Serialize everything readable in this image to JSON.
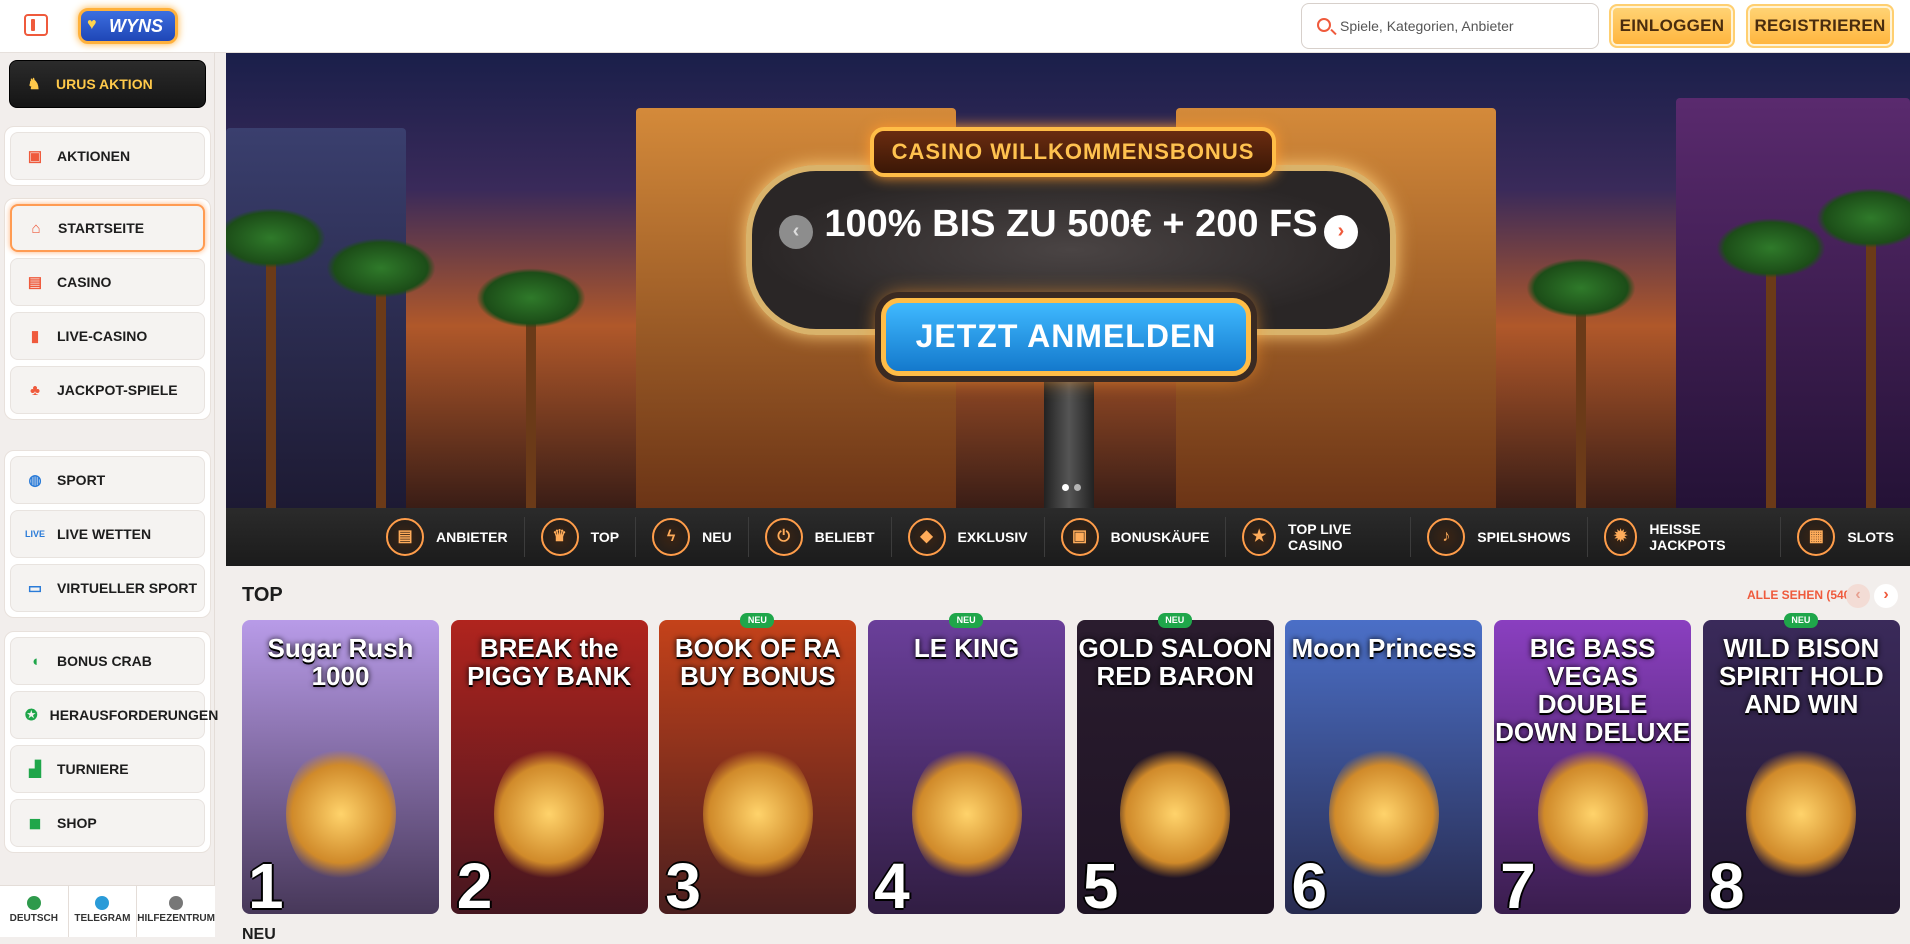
{
  "header": {
    "search_placeholder": "Spiele, Kategorien, Anbieter",
    "login_label": "EINLOGGEN",
    "register_label": "REGISTRIEREN",
    "logo_text": "WYNS"
  },
  "sidebar": {
    "promo": {
      "label": "URUS AKTION",
      "icon": "bull-icon"
    },
    "group1": [
      {
        "label": "AKTIONEN",
        "icon": "gift-icon"
      }
    ],
    "group2": [
      {
        "label": "STARTSEITE",
        "icon": "home-icon"
      },
      {
        "label": "CASINO",
        "icon": "slot-machine-icon"
      },
      {
        "label": "LIVE-CASINO",
        "icon": "cards-icon"
      },
      {
        "label": "JACKPOT-SPIELE",
        "icon": "clover-icon"
      }
    ],
    "group3": [
      {
        "label": "SPORT",
        "icon": "ball-icon"
      },
      {
        "label": "LIVE WETTEN",
        "icon": "live-icon"
      },
      {
        "label": "VIRTUELLER SPORT",
        "icon": "monitor-icon"
      }
    ],
    "group4": [
      {
        "label": "BONUS CRAB",
        "icon": "claw-icon"
      },
      {
        "label": "HERAUSFORDERUNGEN",
        "icon": "medal-icon"
      },
      {
        "label": "TURNIERE",
        "icon": "podium-icon"
      },
      {
        "label": "SHOP",
        "icon": "bag-icon"
      }
    ],
    "bottom": [
      {
        "label": "DEUTSCH",
        "icon": "globe-icon"
      },
      {
        "label": "TELEGRAM",
        "icon": "telegram-icon"
      },
      {
        "label": "HILFEZENTRUM",
        "icon": "help-icon"
      }
    ]
  },
  "banner": {
    "top_sign": "CASINO WILLKOMMENSBONUS",
    "headline": "100% BIS ZU 500€ + 200 FS",
    "cta": "JETZT ANMELDEN",
    "slides": 2,
    "active_slide": 1
  },
  "categories": [
    {
      "label": "ANBIETER",
      "icon": "document-icon"
    },
    {
      "label": "TOP",
      "icon": "crown-icon"
    },
    {
      "label": "NEU",
      "icon": "lightning-icon"
    },
    {
      "label": "BELIEBT",
      "icon": "power-icon"
    },
    {
      "label": "EXKLUSIV",
      "icon": "diamond-icon"
    },
    {
      "label": "BONUSKÄUFE",
      "icon": "gift-icon"
    },
    {
      "label": "TOP LIVE CASINO",
      "icon": "star-icon"
    },
    {
      "label": "SPIELSHOWS",
      "icon": "microphone-icon"
    },
    {
      "label": "HEISSE JACKPOTS",
      "icon": "flame-icon"
    },
    {
      "label": "SLOTS",
      "icon": "slots-icon"
    }
  ],
  "top_section": {
    "title": "TOP",
    "see_all": "ALLE SEHEN (540)"
  },
  "games": [
    {
      "title": "Sugar Rush 1000",
      "rank": "1",
      "badge": "",
      "bg": "#b89be8"
    },
    {
      "title": "BREAK the PIGGY BANK",
      "rank": "2",
      "badge": "",
      "bg": "#b0241e"
    },
    {
      "title": "BOOK OF RA BUY BONUS",
      "rank": "3",
      "badge": "NEU",
      "bg": "#c4421a"
    },
    {
      "title": "LE KING",
      "rank": "4",
      "badge": "NEU",
      "bg": "#6a3f9a"
    },
    {
      "title": "GOLD SALOON RED BARON",
      "rank": "5",
      "badge": "NEU",
      "bg": "#2a1c2e"
    },
    {
      "title": "Moon Princess",
      "rank": "6",
      "badge": "",
      "bg": "#4b6fc7"
    },
    {
      "title": "BIG BASS VEGAS DOUBLE DOWN DELUXE",
      "rank": "7",
      "badge": "",
      "bg": "#8a3fc0"
    },
    {
      "title": "WILD BISON SPIRIT HOLD AND WIN",
      "rank": "8",
      "badge": "NEU",
      "bg": "#3a2a5a"
    }
  ],
  "next_section_partial": "NEU"
}
